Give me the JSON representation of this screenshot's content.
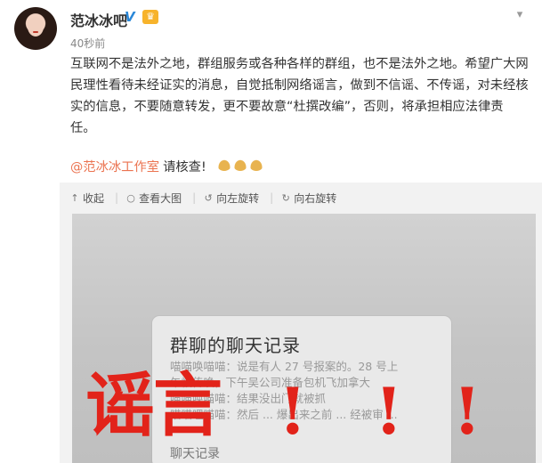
{
  "post": {
    "author": "范冰冰吧",
    "badge_v": "V",
    "badge_crown": "♛",
    "timestamp": "40秒前",
    "body": "互联网不是法外之地，群组服务或各种各样的群组，也不是法外之地。希望广大网民理性看待未经证实的消息，自觉抵制网络谣言，做到不信谣、不传谣，对未经核实的信息，不要随意转发，更不要故意“杜撰改编”，否则，将承担相应法律责任。",
    "mention": "@范冰冰工作室",
    "mention_suffix": "请核查!"
  },
  "toolbar": {
    "collapse_icon": "↑",
    "collapse": "收起",
    "view_icon": "○",
    "view": "查看大图",
    "rotate_left_icon": "↺",
    "rotate_left": "向左旋转",
    "rotate_right_icon": "↻",
    "rotate_right": "向右旋转"
  },
  "image": {
    "chat_title": "群聊的聊天记录",
    "chat_lines": [
      "喵喵唤喵喵：说是有人 27 号报案的。28 号上",
      "午被传唤，下午吴公司准备包机飞加拿大",
      "喵喵唤喵喵：结果没出门就被抓",
      "喵喵哩喵喵：然后 ... 爆出来之前 ... 经被审 ..."
    ],
    "chat_footer": "聊天记录",
    "stamp_text": "谣言",
    "exclaim": "!"
  },
  "colors": {
    "accent": "#eb7350",
    "stamp": "#e2231a",
    "verified": "#2a87d8"
  }
}
